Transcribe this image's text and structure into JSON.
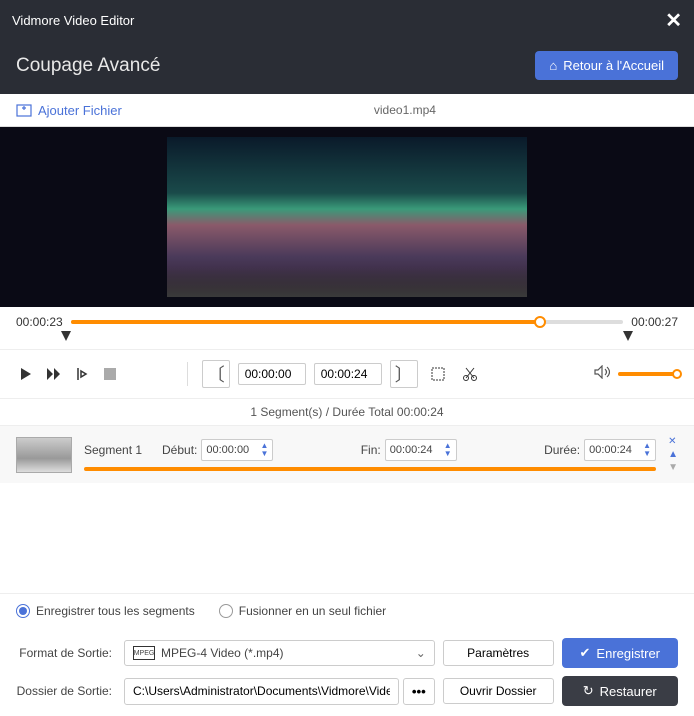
{
  "app": {
    "title": "Vidmore Video Editor"
  },
  "header": {
    "title": "Coupage Avancé",
    "home_btn": "Retour à l'Accueil"
  },
  "toolbar": {
    "add_file": "Ajouter Fichier",
    "filename": "video1.mp4"
  },
  "timeline": {
    "current": "00:00:23",
    "total": "00:00:27",
    "fill_pct": "85%"
  },
  "controls": {
    "start_time": "00:00:00",
    "end_time": "00:00:24"
  },
  "segments": {
    "summary": "1 Segment(s) / Durée Total 00:00:24",
    "list": [
      {
        "name": "Segment 1",
        "start_label": "Début:",
        "start": "00:00:00",
        "end_label": "Fin:",
        "end": "00:00:24",
        "duration_label": "Durée:",
        "duration": "00:00:24"
      }
    ]
  },
  "options": {
    "save_all": "Enregistrer tous les segments",
    "merge": "Fusionner en un seul fichier"
  },
  "footer": {
    "format_label": "Format de Sortie:",
    "format_value": "MPEG-4 Video (*.mp4)",
    "params_btn": "Paramètres",
    "folder_label": "Dossier de Sortie:",
    "folder_value": "C:\\Users\\Administrator\\Documents\\Vidmore\\Video",
    "open_folder_btn": "Ouvrir Dossier",
    "save_btn": "Enregistrer",
    "restore_btn": "Restaurer"
  }
}
